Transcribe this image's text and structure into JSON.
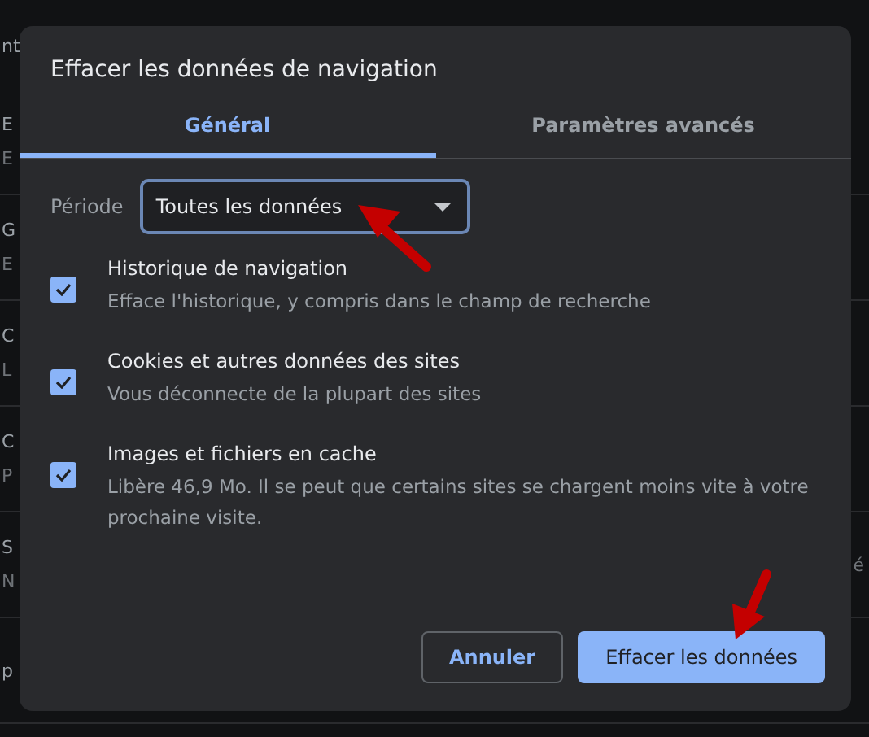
{
  "background_page": {
    "heading_fragment": "nt",
    "rows": [
      {
        "title": "E",
        "subtitle": "E"
      },
      {
        "title": "G",
        "subtitle": "E"
      },
      {
        "title": "C",
        "subtitle": "L"
      },
      {
        "title": "C",
        "subtitle": "P"
      },
      {
        "title": "S",
        "subtitle": "N",
        "trailing": "é"
      },
      {
        "title": "p"
      }
    ]
  },
  "dialog": {
    "title": "Effacer les données de navigation",
    "tabs": [
      {
        "label": "Général",
        "selected": true
      },
      {
        "label": "Paramètres avancés",
        "selected": false
      }
    ],
    "period": {
      "label": "Période",
      "value": "Toutes les données"
    },
    "options": [
      {
        "title": "Historique de navigation",
        "description": "Efface l'historique, y compris dans le champ de recherche",
        "checked": true
      },
      {
        "title": "Cookies et autres données des sites",
        "description": "Vous déconnecte de la plupart des sites",
        "checked": true
      },
      {
        "title": "Images et fichiers en cache",
        "description": "Libère 46,9 Mo. Il se peut que certains sites se chargent moins vite à votre prochaine visite.",
        "checked": true
      }
    ],
    "buttons": [
      {
        "label": "Annuler",
        "kind": "secondary"
      },
      {
        "label": "Effacer les données",
        "kind": "primary"
      }
    ]
  }
}
